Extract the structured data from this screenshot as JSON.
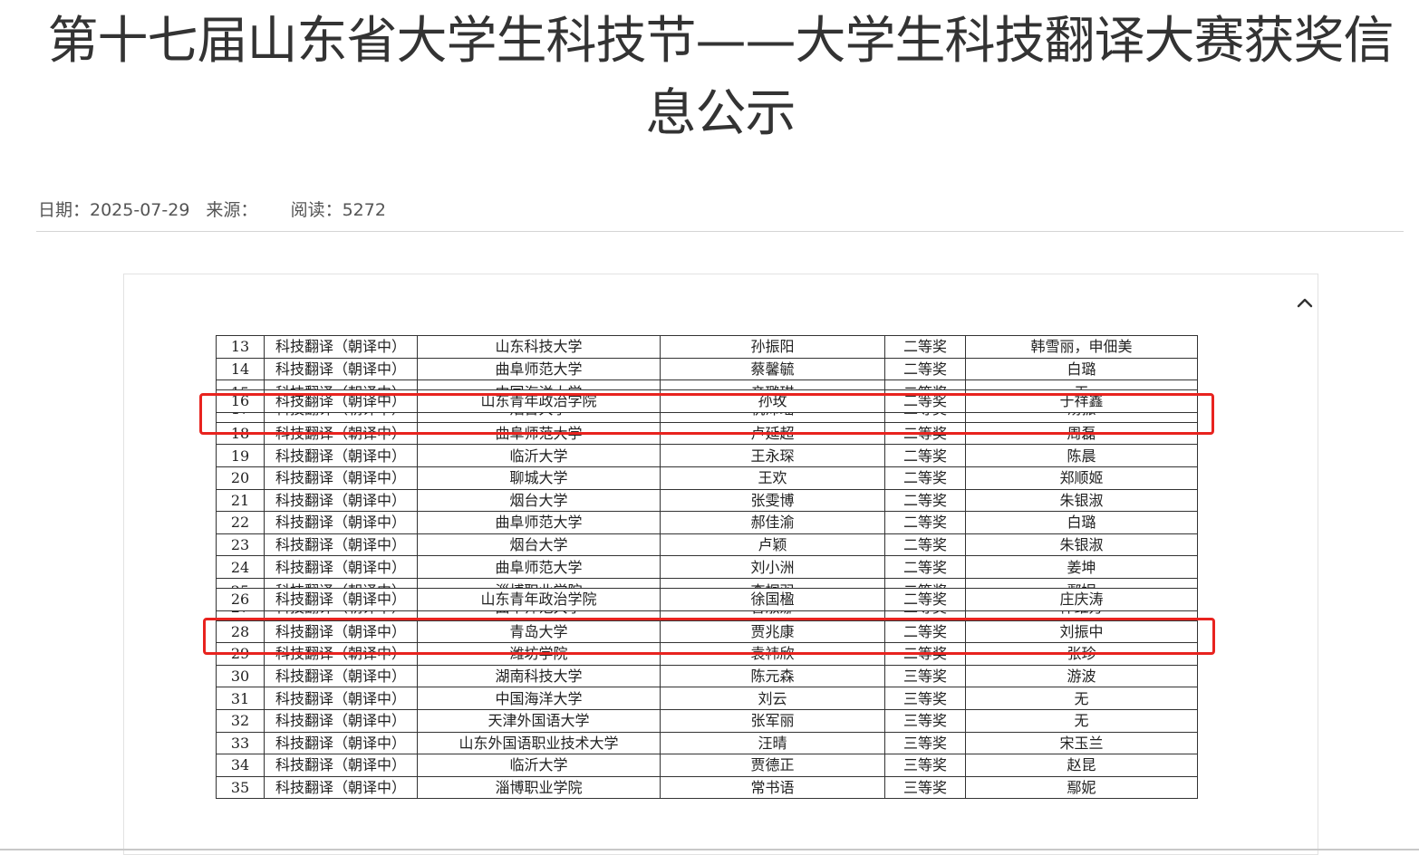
{
  "article": {
    "title": "第十七届山东省大学生科技节——大学生科技翻译大赛获奖信息公示",
    "meta": {
      "date_label": "日期：2025-07-29",
      "source_label": "来源：",
      "reads_label": "阅读：5272"
    }
  },
  "colors": {
    "highlight": "#e8231f",
    "text": "#333333"
  },
  "icons": {
    "scroll_up": "chevron-up-icon"
  },
  "table": {
    "rows": [
      {
        "no": "13",
        "category": "科技翻译（朝译中）",
        "school": "山东科技大学",
        "name": "孙振阳",
        "award": "二等奖",
        "advisor": "韩雪丽，申佃美"
      },
      {
        "no": "14",
        "category": "科技翻译（朝译中）",
        "school": "曲阜师范大学",
        "name": "蔡馨毓",
        "award": "二等奖",
        "advisor": "白璐"
      },
      {
        "no": "15",
        "category": "科技翻译（朝译中）",
        "school": "中国海洋大学",
        "name": "辛璐琪",
        "award": "二等奖",
        "advisor": "无"
      },
      {
        "no": "16",
        "category": "科技翻译（朝译中）",
        "school": "山东青年政治学院",
        "name": "孙玫",
        "award": "二等奖",
        "advisor": "于祥鑫"
      },
      {
        "no": "17",
        "category": "科技翻译（朝译中）",
        "school": "烟台大学",
        "name": "杭沛瑶",
        "award": "二等奖",
        "advisor": "汤振"
      },
      {
        "no": "18",
        "category": "科技翻译（朝译中）",
        "school": "曲阜师范大学",
        "name": "卢延超",
        "award": "二等奖",
        "advisor": "周磊"
      },
      {
        "no": "19",
        "category": "科技翻译（朝译中）",
        "school": "临沂大学",
        "name": "王永琛",
        "award": "二等奖",
        "advisor": "陈晨"
      },
      {
        "no": "20",
        "category": "科技翻译（朝译中）",
        "school": "聊城大学",
        "name": "王欢",
        "award": "二等奖",
        "advisor": "郑顺姬"
      },
      {
        "no": "21",
        "category": "科技翻译（朝译中）",
        "school": "烟台大学",
        "name": "张雯博",
        "award": "二等奖",
        "advisor": "朱银淑"
      },
      {
        "no": "22",
        "category": "科技翻译（朝译中）",
        "school": "曲阜师范大学",
        "name": "郝佳渝",
        "award": "二等奖",
        "advisor": "白璐"
      },
      {
        "no": "23",
        "category": "科技翻译（朝译中）",
        "school": "烟台大学",
        "name": "卢颖",
        "award": "二等奖",
        "advisor": "朱银淑"
      },
      {
        "no": "24",
        "category": "科技翻译（朝译中）",
        "school": "曲阜师范大学",
        "name": "刘小洲",
        "award": "二等奖",
        "advisor": "姜坤"
      },
      {
        "no": "25",
        "category": "科技翻译（朝译中）",
        "school": "淄博职业学院",
        "name": "李桐羽",
        "award": "二等奖",
        "advisor": "鄢妮"
      },
      {
        "no": "26",
        "category": "科技翻译（朝译中）",
        "school": "山东青年政治学院",
        "name": "徐国楹",
        "award": "二等奖",
        "advisor": "庄庆涛"
      },
      {
        "no": "27",
        "category": "科技翻译（朝译中）",
        "school": "曲阜师范大学",
        "name": "曹淑娜",
        "award": "二等奖",
        "advisor": "仲维方"
      },
      {
        "no": "28",
        "category": "科技翻译（朝译中）",
        "school": "青岛大学",
        "name": "贾兆康",
        "award": "二等奖",
        "advisor": "刘振中"
      },
      {
        "no": "29",
        "category": "科技翻译（朝译中）",
        "school": "潍坊学院",
        "name": "袁祎欣",
        "award": "二等奖",
        "advisor": "张珍"
      },
      {
        "no": "30",
        "category": "科技翻译（朝译中）",
        "school": "湖南科技大学",
        "name": "陈元森",
        "award": "三等奖",
        "advisor": "游波"
      },
      {
        "no": "31",
        "category": "科技翻译（朝译中）",
        "school": "中国海洋大学",
        "name": "刘云",
        "award": "三等奖",
        "advisor": "无"
      },
      {
        "no": "32",
        "category": "科技翻译（朝译中）",
        "school": "天津外国语大学",
        "name": "张军丽",
        "award": "三等奖",
        "advisor": "无"
      },
      {
        "no": "33",
        "category": "科技翻译（朝译中）",
        "school": "山东外国语职业技术大学",
        "name": "汪晴",
        "award": "三等奖",
        "advisor": "宋玉兰"
      },
      {
        "no": "34",
        "category": "科技翻译（朝译中）",
        "school": "临沂大学",
        "name": "贾德正",
        "award": "三等奖",
        "advisor": "赵昆"
      },
      {
        "no": "35",
        "category": "科技翻译（朝译中）",
        "school": "淄博职业学院",
        "name": "常书语",
        "award": "三等奖",
        "advisor": "鄢妮"
      }
    ]
  }
}
